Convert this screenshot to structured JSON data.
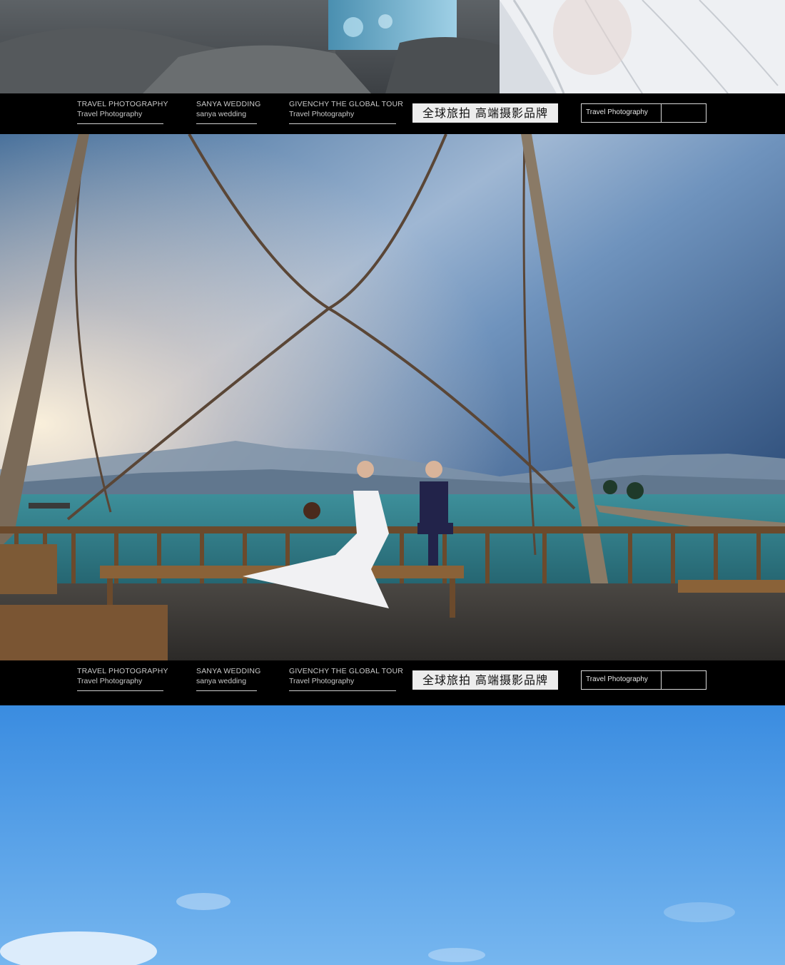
{
  "bars": [
    {
      "col1": {
        "line1": "TRAVEL PHOTOGRAPHY",
        "line2": "Travel Photography"
      },
      "col2": {
        "line1": "SANYA WEDDING",
        "line2": "sanya wedding"
      },
      "col3": {
        "line1": "GIVENCHY THE GLOBAL TOUR",
        "line2": "Travel Photography"
      },
      "slogan": "全球旅拍  高端摄影品牌",
      "button": "Travel Photography"
    },
    {
      "col1": {
        "line1": "TRAVEL PHOTOGRAPHY",
        "line2": "Travel Photography"
      },
      "col2": {
        "line1": "SANYA WEDDING",
        "line2": "sanya wedding"
      },
      "col3": {
        "line1": "GIVENCHY THE GLOBAL TOUR",
        "line2": "Travel Photography"
      },
      "slogan": "全球旅拍  高端摄影品牌",
      "button": "Travel Photography"
    }
  ],
  "colors": {
    "bar_bg": "#000000",
    "sky_top": "#1b3a66",
    "sea": "#2f7d86",
    "deck": "#7a5a3a",
    "clear_sky": "#3f8fe0"
  },
  "photos": [
    "photo-rocks-dress",
    "photo-couple-on-ship-deck",
    "photo-blue-sky"
  ]
}
